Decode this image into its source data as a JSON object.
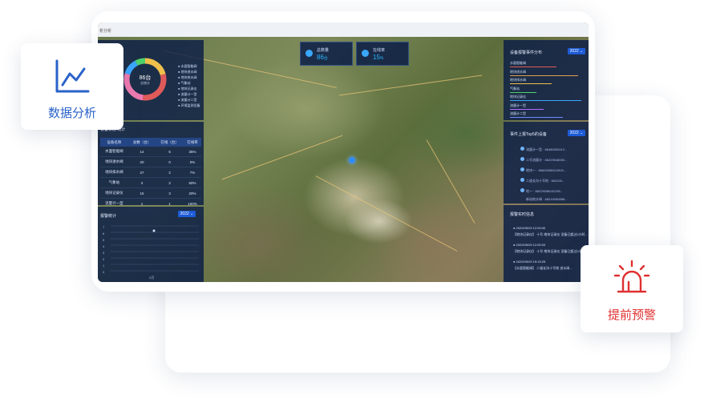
{
  "dashboard": {
    "window_title": "析分析",
    "stats": [
      {
        "label": "总数量",
        "value": "86",
        "unit": "台"
      },
      {
        "label": "在线率",
        "value": "15",
        "unit": "%"
      }
    ],
    "donut": {
      "value": "86台",
      "label": "总统计"
    },
    "device_types": [
      "水面智能阀",
      "地块进水阀",
      "地块排水阀",
      "气象站",
      "地块记录仪",
      "流量计一型",
      "流量计二型",
      "环境监测设备"
    ],
    "device_status": {
      "title": "设备状态",
      "subtitle": "统计",
      "columns": [
        "设备名称",
        "总数（台）",
        "在线（台）",
        "在线率"
      ],
      "rows": [
        {
          "name": "水面智能阀",
          "total": "14",
          "online": "5",
          "rate": "35%"
        },
        {
          "name": "地块进水阀",
          "total": "20",
          "online": "0",
          "rate": "0%"
        },
        {
          "name": "地块排水阀",
          "total": "27",
          "online": "2",
          "rate": "7%"
        },
        {
          "name": "气象站",
          "total": "4",
          "online": "2",
          "rate": "50%"
        },
        {
          "name": "地块记录仪",
          "total": "15",
          "online": "3",
          "rate": "20%"
        },
        {
          "name": "流量计一型",
          "total": "1",
          "online": "1",
          "rate": "100%"
        }
      ]
    },
    "alarm_stats": {
      "title": "报警统计",
      "year": "2022",
      "y_ticks": [
        "7",
        "6",
        "5",
        "4",
        "3",
        "2",
        "1",
        "0"
      ],
      "x_label": "2月"
    },
    "event_distribution": {
      "title": "设备报警事件分布",
      "year": "2022",
      "items": [
        {
          "label": "水面智能阀",
          "color": "#e05a5a",
          "level": 0.62
        },
        {
          "label": "地块进水阀",
          "color": "#e0a050",
          "level": 0.9
        },
        {
          "label": "地块排水阀",
          "color": "#f0c04a",
          "level": 0.55
        },
        {
          "label": "气象站",
          "color": "#4fd16a",
          "level": 0.35
        },
        {
          "label": "地块记录仪",
          "color": "#3aa7ff",
          "level": 0.95
        },
        {
          "label": "流量计一型",
          "color": "#b070ff",
          "level": 0.45
        },
        {
          "label": "流量计二型",
          "color": "#6f8cff",
          "level": 0.7
        }
      ]
    },
    "top_devices": {
      "title": "事件上报Top5的设备",
      "year": "2022",
      "items": [
        "流量计一型 · 86480000412...",
        "二号流量计 · 86229048000...",
        "地块一 · 86600058412815...",
        "二道长沟十号地 · 862200...",
        "地一 · 86229058041295..."
      ],
      "extra": "新站地水阀 · 86019050888..."
    },
    "realtime_alarms": {
      "title": "报警实时信息",
      "items": [
        {
          "time": "2022/05/29 12:00:00",
          "text": "【地块记录仪】 十号 地块记录仪 设备已超过2小时..."
        },
        {
          "time": "2022/05/29 12:00:03",
          "text": "【地块记录仪】 十号 地块记录仪 设备已超过2小时..."
        },
        {
          "time": "2022/05/29 15:15:25",
          "text": "【水面智能阀】 二道长沟十号地 进水阀..."
        }
      ]
    }
  },
  "features": {
    "data_analysis": {
      "label": "数据分析",
      "icon": "line-chart-icon",
      "color": "#2a62c9"
    },
    "early_warning": {
      "label": "提前预警",
      "icon": "siren-icon",
      "color": "#e03030"
    }
  }
}
